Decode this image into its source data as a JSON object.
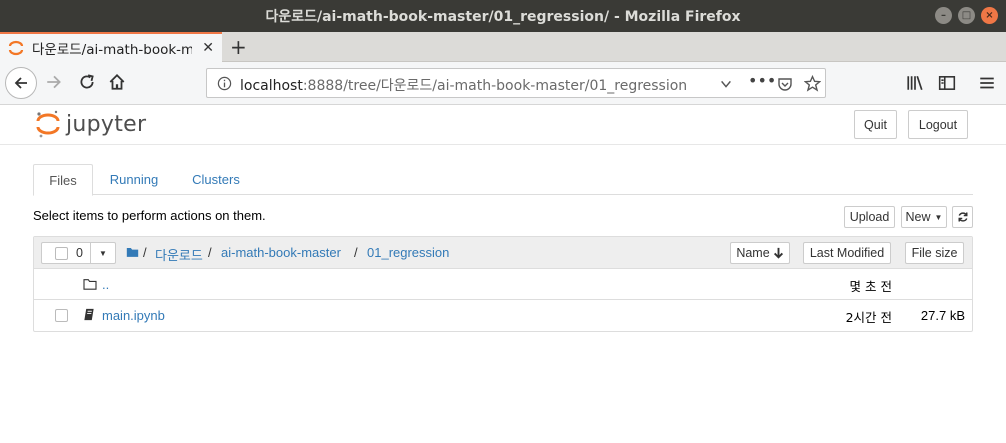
{
  "window": {
    "title": "다운로드/ai-math-book-master/01_regression/ - Mozilla Firefox"
  },
  "browser": {
    "tab_title": "다운로드/ai-math-book-m",
    "url_host": "localhost",
    "url_rest": ":8888/tree/다운로드/ai-math-book-master/01_regression"
  },
  "jupyter": {
    "logo_text": "jupyter",
    "quit_label": "Quit",
    "logout_label": "Logout",
    "tabs": [
      "Files",
      "Running",
      "Clusters"
    ],
    "select_info": "Select items to perform actions on them.",
    "upload_label": "Upload",
    "new_label": "New",
    "selected_count": "0",
    "breadcrumb": [
      "/",
      "다운로드",
      "/",
      "ai-math-book-master",
      "/",
      "01_regression"
    ],
    "columns": {
      "name": "Name",
      "modified": "Last Modified",
      "size": "File size"
    },
    "rows": [
      {
        "name": "..",
        "modified": "몇 초 전",
        "size": ""
      },
      {
        "name": "main.ipynb",
        "modified": "2시간 전",
        "size": "27.7 kB"
      }
    ]
  }
}
